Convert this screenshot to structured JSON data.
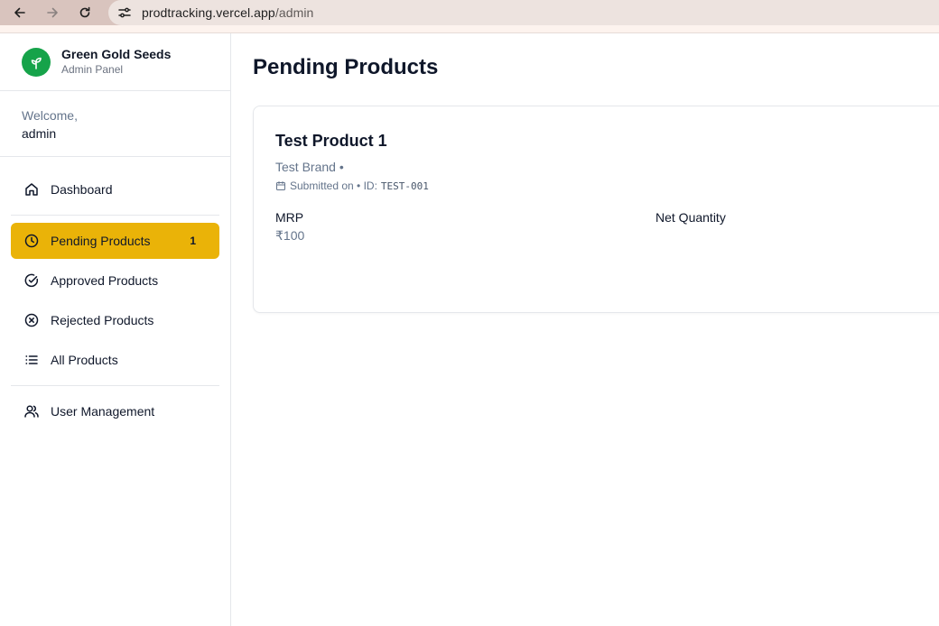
{
  "browser": {
    "url_host": "prodtracking.vercel.app",
    "url_path": "/admin"
  },
  "sidebar": {
    "brand_name": "Green Gold Seeds",
    "brand_sub": "Admin Panel",
    "welcome_label": "Welcome,",
    "welcome_user": "admin",
    "items": [
      {
        "label": "Dashboard",
        "icon": "home-icon"
      },
      {
        "label": "Pending Products",
        "icon": "clock-icon",
        "badge": "1",
        "active": true
      },
      {
        "label": "Approved Products",
        "icon": "check-circle-icon"
      },
      {
        "label": "Rejected Products",
        "icon": "x-circle-icon"
      },
      {
        "label": "All Products",
        "icon": "list-icon"
      },
      {
        "label": "User Management",
        "icon": "users-icon"
      }
    ]
  },
  "main": {
    "title": "Pending Products",
    "product": {
      "name": "Test Product 1",
      "brand": "Test Brand •",
      "submitted": "Submitted on • ID:",
      "id": "TEST-001",
      "mrp_label": "MRP",
      "mrp_value": "₹100",
      "net_quantity_label": "Net Quantity"
    }
  },
  "colors": {
    "accent": "#eab308",
    "brand_green": "#16a34a"
  }
}
